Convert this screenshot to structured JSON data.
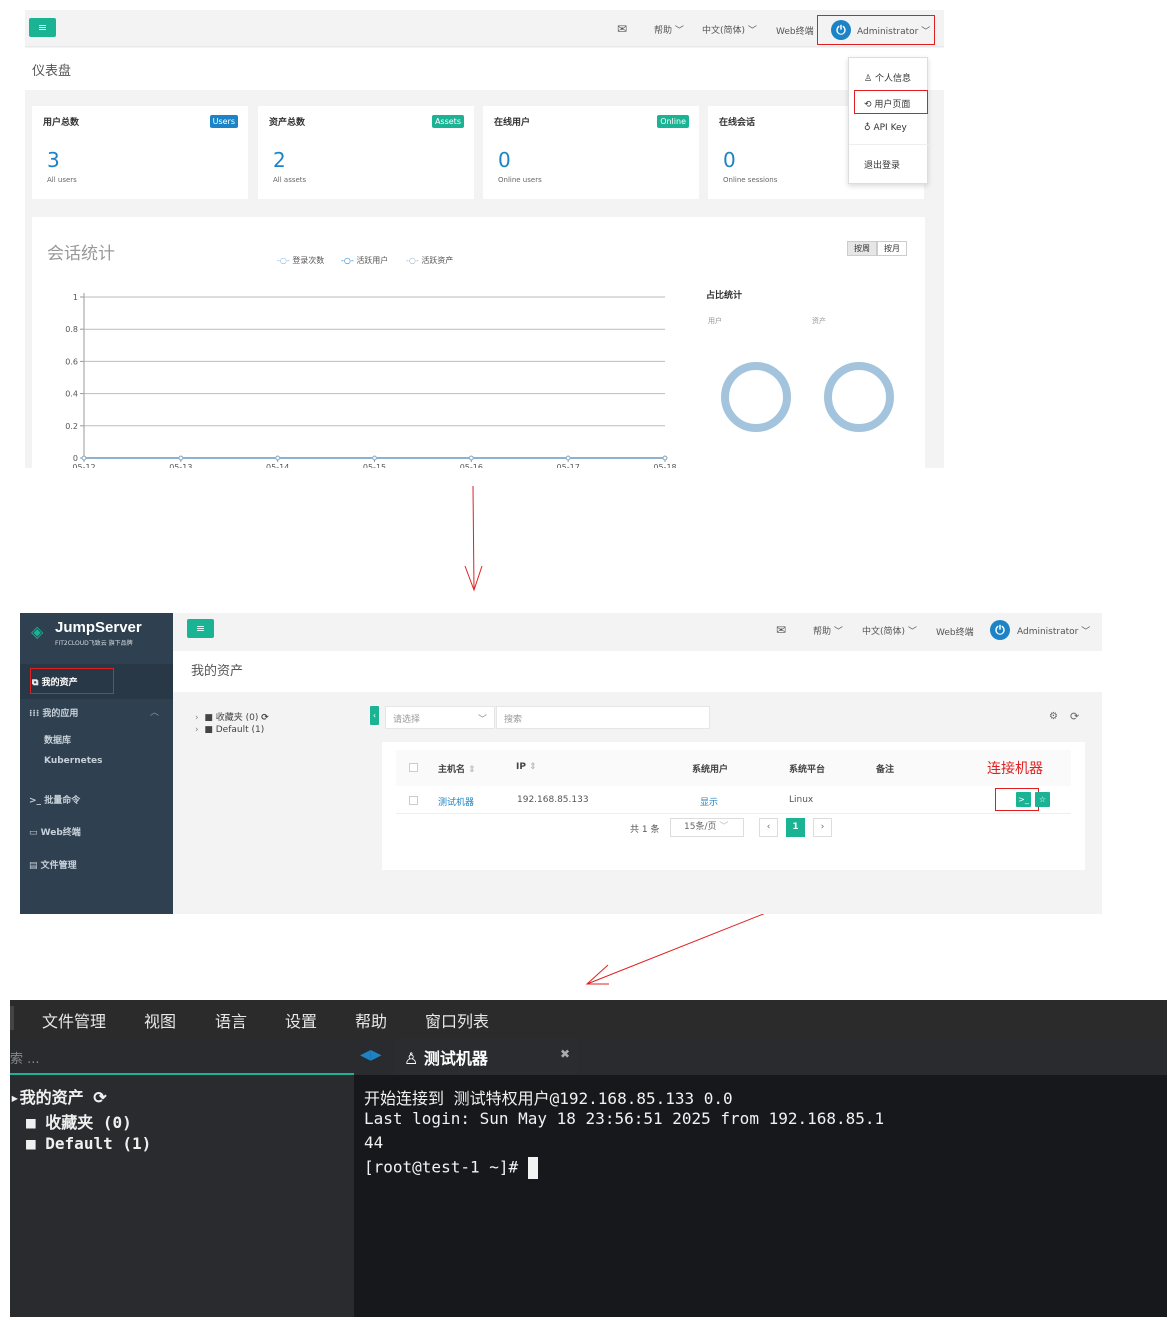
{
  "dashboard": {
    "nav": {
      "help": "帮助",
      "language": "中文(简体)",
      "web_terminal": "Web终端",
      "user": "Administrator"
    },
    "page_title": "仪表盘",
    "cards": [
      {
        "title": "用户总数",
        "badge": "Users",
        "value": "3",
        "sub": "All users"
      },
      {
        "title": "资产总数",
        "badge": "Assets",
        "value": "2",
        "sub": "All assets"
      },
      {
        "title": "在线用户",
        "badge": "Online",
        "value": "0",
        "sub": "Online users"
      },
      {
        "title": "在线会话",
        "badge": "",
        "value": "0",
        "sub": "Online sessions"
      }
    ],
    "user_menu": [
      {
        "icon": "person-icon",
        "label": "个人信息"
      },
      {
        "icon": "user-page-icon",
        "label": "用户页面"
      },
      {
        "icon": "key-icon",
        "label": "API Key"
      },
      {
        "icon": "",
        "label": "退出登录"
      }
    ],
    "chart_title": "会话统计",
    "toggle": {
      "week": "按周",
      "month": "按月"
    },
    "ratio_title": "占比统计",
    "ratio_labels": {
      "users": "用户",
      "assets": "资产"
    }
  },
  "chart_data": {
    "type": "line",
    "x": [
      "05-12",
      "05-13",
      "05-14",
      "05-15",
      "05-16",
      "05-17",
      "05-18"
    ],
    "series": [
      {
        "name": "登录次数",
        "values": [
          0,
          0,
          0,
          0,
          0,
          0,
          0
        ]
      },
      {
        "name": "活跃用户",
        "values": [
          0,
          0,
          0,
          0,
          0,
          0,
          0
        ]
      },
      {
        "name": "活跃资产",
        "values": [
          0,
          0,
          0,
          0,
          0,
          0,
          0
        ]
      }
    ],
    "yticks": [
      "0",
      "0.2",
      "0.4",
      "0.6",
      "0.8",
      "1"
    ],
    "ylim": [
      0,
      1
    ],
    "grid": true,
    "legend": "top"
  },
  "assets_page": {
    "logo": {
      "title": "JumpServer",
      "subtitle": "FIT2CLOUD飞致云 旗下品牌"
    },
    "sidebar": [
      {
        "icon": "assets-icon",
        "label": "我的资产"
      },
      {
        "icon": "apps-icon",
        "label": "我的应用"
      },
      {
        "icon": "",
        "label": "数据库"
      },
      {
        "icon": "",
        "label": "Kubernetes"
      },
      {
        "icon": "terminal-icon",
        "label": "批量命令"
      },
      {
        "icon": "window-icon",
        "label": "Web终端"
      },
      {
        "icon": "file-icon",
        "label": "文件管理"
      }
    ],
    "nav": {
      "help": "帮助",
      "language": "中文(简体)",
      "web_terminal": "Web终端",
      "user": "Administrator"
    },
    "page_title": "我的资产",
    "tree": [
      "收藏夹 (0)",
      "Default (1)"
    ],
    "filter": {
      "select_placeholder": "请选择",
      "search_placeholder": "搜索"
    },
    "table": {
      "columns": [
        "主机名",
        "IP",
        "系统用户",
        "系统平台",
        "备注"
      ],
      "rows": [
        {
          "hostname": "测试机器",
          "ip": "192.168.85.133",
          "system_user": "显示",
          "platform": "Linux",
          "note": ""
        }
      ]
    },
    "pagination": {
      "total": "共 1 条",
      "page_size": "15条/页",
      "current": "1"
    },
    "annotation": "连接机器"
  },
  "terminal": {
    "menu": [
      "文件管理",
      "视图",
      "语言",
      "设置",
      "帮助",
      "窗口列表"
    ],
    "search_placeholder": "索 ...",
    "tree_root": "我的资产",
    "tree": [
      "收藏夹 (0)",
      "Default (1)"
    ],
    "tab_label": "测试机器",
    "lines": [
      "开始连接到 测试特权用户@192.168.85.133 0.0",
      "Last login: Sun May 18 23:56:51 2025 from 192.168.85.1",
      "44",
      "[root@test-1 ~]# "
    ]
  },
  "colors": {
    "accent_green": "#1ab394",
    "accent_blue": "#1c84c6",
    "sidebar_dark": "#2f4050",
    "annotation_red": "#e02020",
    "donut": "#a3c4dc"
  }
}
